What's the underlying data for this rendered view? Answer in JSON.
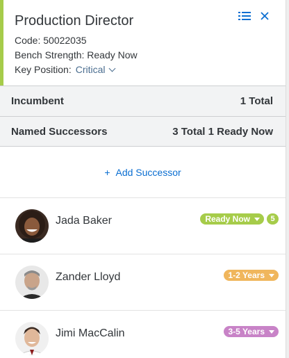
{
  "position": {
    "title": "Production Director",
    "code_label": "Code: 50022035",
    "bench_label": "Bench Strength: Ready Now",
    "key_label": "Key Position:",
    "key_value": "Critical",
    "accent_color": "#a6cc4a"
  },
  "header_icons": [
    "list-icon",
    "close-icon"
  ],
  "incumbent": {
    "label": "Incumbent",
    "total": "1 Total"
  },
  "named_successors": {
    "label": "Named Successors",
    "total": "3 Total 1 Ready Now"
  },
  "add_successor": {
    "label": "Add Successor"
  },
  "successors": [
    {
      "name": "Jada Baker",
      "readiness": "Ready Now",
      "color": "#a6cc4a",
      "count": "5"
    },
    {
      "name": "Zander Lloyd",
      "readiness": "1-2 Years",
      "color": "#f0b65c",
      "count": ""
    },
    {
      "name": "Jimi MacCalin",
      "readiness": "3-5 Years",
      "color": "#c883c7",
      "count": ""
    }
  ]
}
